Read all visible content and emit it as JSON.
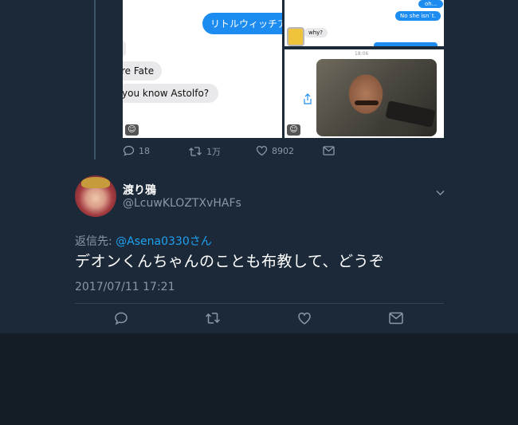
{
  "media": {
    "left": {
      "bubble_1": "リトルウィッチア",
      "bubble_2": "re Fate",
      "bubble_3": "you know  Astolfo?",
      "emoji_glyph": "☺"
    },
    "right_top": {
      "bubble_1": "oh...",
      "bubble_2": "No she isn`t.",
      "bubble_3": "why?",
      "emoji_glyph": "☺"
    },
    "right_bottom": {
      "time": "18:06",
      "emoji_glyph": "☺"
    }
  },
  "parent_actions": {
    "reply_count": "18",
    "retweet_count": "1万",
    "like_count": "8902"
  },
  "reply_tweet": {
    "display_name": "渡り鴉",
    "handle": "@LcuwKLOZTXvHAFs",
    "reply_to_prefix": "返信先: ",
    "reply_to_user": "@Asena0330さん",
    "text": "デオンくんちゃんのことも布教して、どうぞ",
    "timestamp": "2017/07/11 17:21"
  },
  "icons": {
    "reply": "reply-icon",
    "retweet": "retweet-icon",
    "like": "heart-icon",
    "dm": "mail-icon",
    "caret": "chevron-down-icon",
    "share": "share-icon"
  },
  "colors": {
    "background": "#141d26",
    "panel": "#1c2938",
    "accent": "#1da1f2",
    "muted": "#8899a6",
    "bubble_blue": "#1d8cf0"
  }
}
